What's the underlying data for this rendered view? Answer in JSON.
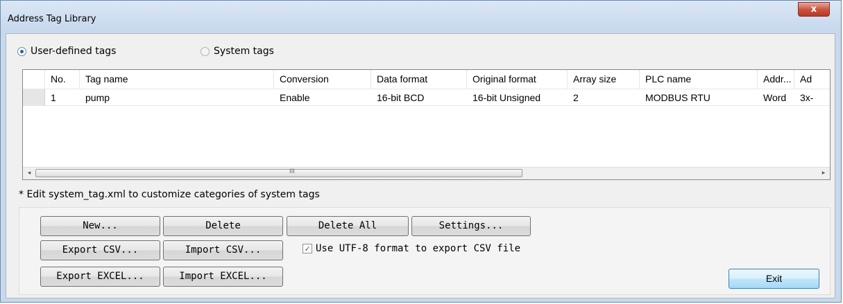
{
  "window": {
    "title": "Address Tag Library",
    "close_glyph": "x"
  },
  "tag_type": {
    "user_defined": "User-defined tags",
    "system": "System tags",
    "selected": "User-defined tags"
  },
  "grid": {
    "columns": [
      "No.",
      "Tag name",
      "Conversion",
      "Data format",
      "Original format",
      "Array size",
      "PLC name",
      "Addr...",
      "Ad"
    ],
    "rows": [
      {
        "no": "1",
        "tag_name": "pump",
        "conversion": "Enable",
        "data_format": "16-bit BCD",
        "original_format": "16-bit Unsigned",
        "array_size": "2",
        "plc_name": "MODBUS RTU",
        "addr_type": "Word",
        "address": "3x-"
      }
    ],
    "scroll_left": "◂",
    "scroll_right": "▸",
    "scroll_grip": "III"
  },
  "note": "* Edit system_tag.xml to customize categories of system tags",
  "buttons": {
    "new": "New...",
    "delete": "Delete",
    "delete_all": "Delete All",
    "settings": "Settings...",
    "export_csv": "Export CSV...",
    "import_csv": "Import CSV...",
    "export_excel": "Export EXCEL...",
    "import_excel": "Import EXCEL...",
    "exit": "Exit"
  },
  "utf8_option": {
    "label": "Use UTF-8 format to export CSV file",
    "checked": true,
    "check_glyph": "✓"
  }
}
